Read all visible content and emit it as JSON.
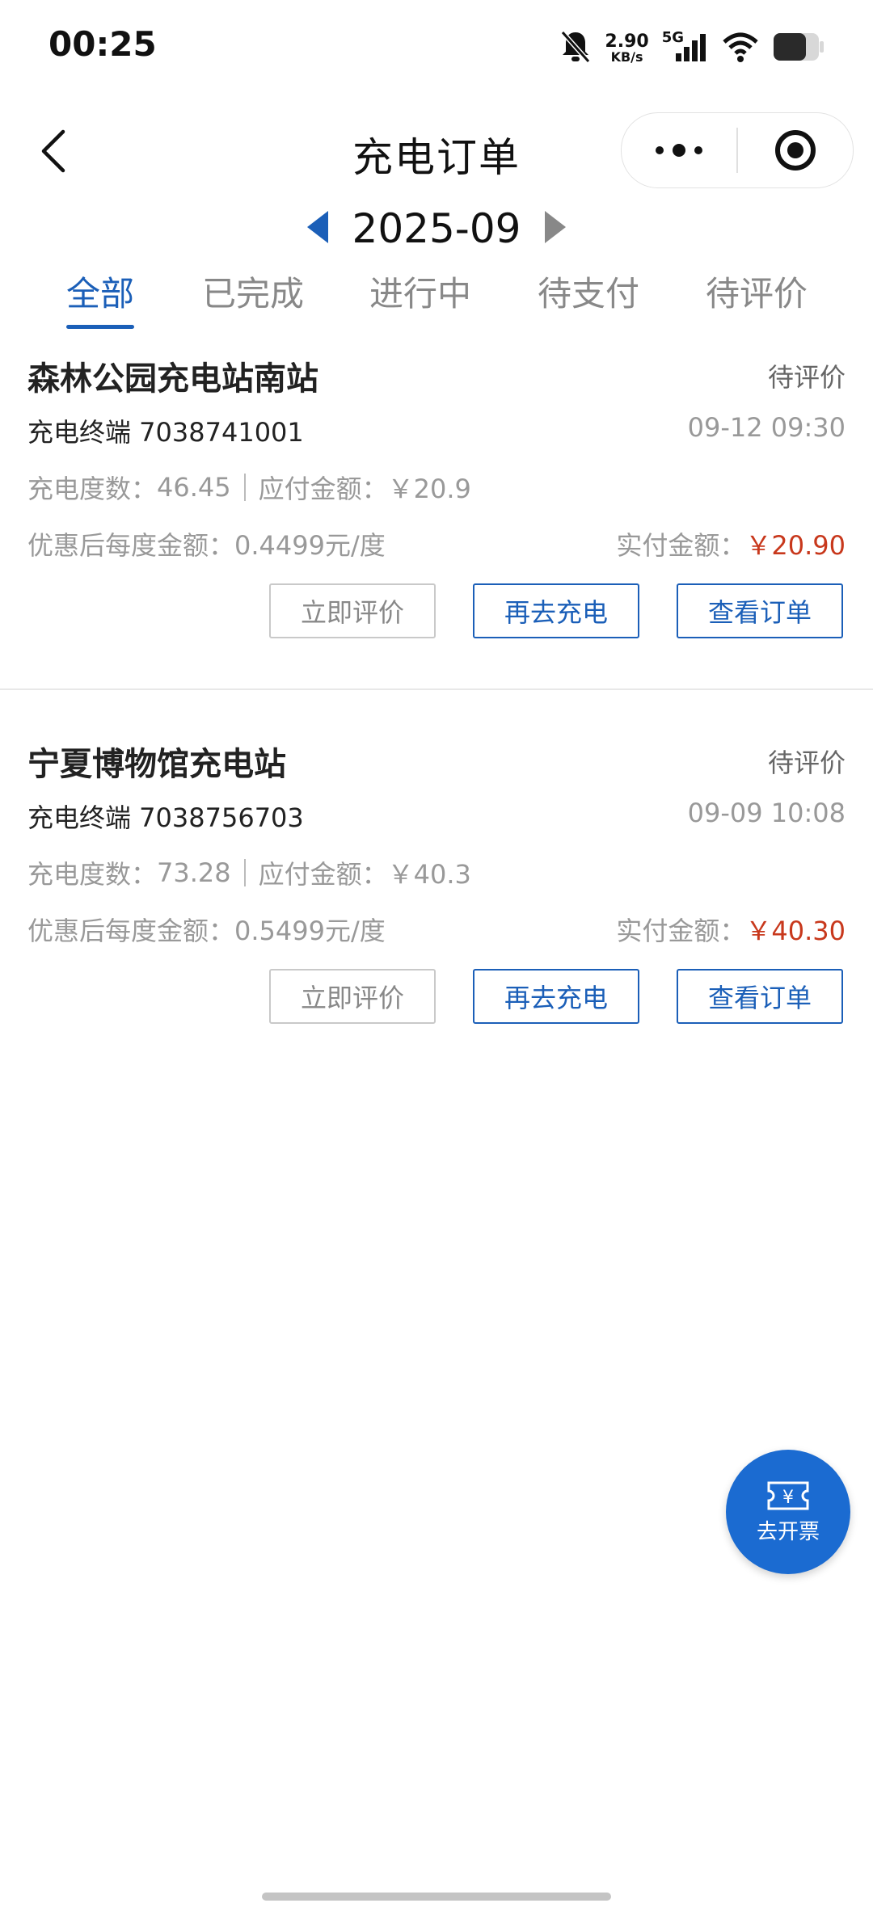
{
  "status_bar": {
    "time": "00:25",
    "net_speed_value": "2.90",
    "net_speed_unit": "KB/s",
    "network_type": "5G"
  },
  "nav": {
    "title": "充电订单"
  },
  "month_selector": {
    "month": "2025-09",
    "prev_color": "#1b5fb8",
    "next_color": "#888888"
  },
  "tabs": [
    {
      "label": "全部",
      "active": true
    },
    {
      "label": "已完成",
      "active": false
    },
    {
      "label": "进行中",
      "active": false
    },
    {
      "label": "待支付",
      "active": false
    },
    {
      "label": "待评价",
      "active": false
    }
  ],
  "orders": [
    {
      "station": "森林公园充电站南站",
      "status": "待评价",
      "terminal": "充电终端 7038741001",
      "time": "09-12 09:30",
      "kwh_label": "充电度数：",
      "kwh": "46.45",
      "due_label": "应付金额：",
      "due": "￥20.9",
      "unit_price_label": "优惠后每度金额：",
      "unit_price": "0.4499元/度",
      "paid_label": "实付金额：",
      "paid": "￥20.90",
      "buttons": [
        "立即评价",
        "再去充电",
        "查看订单"
      ]
    },
    {
      "station": "宁夏博物馆充电站",
      "status": "待评价",
      "terminal": "充电终端 7038756703",
      "time": "09-09 10:08",
      "kwh_label": "充电度数：",
      "kwh": "73.28",
      "due_label": "应付金额：",
      "due": "￥40.3",
      "unit_price_label": "优惠后每度金额：",
      "unit_price": "0.5499元/度",
      "paid_label": "实付金额：",
      "paid": "￥40.30",
      "buttons": [
        "立即评价",
        "再去充电",
        "查看订单"
      ]
    }
  ],
  "fab": {
    "label": "去开票",
    "icon_text": "¥",
    "color": "#1b6bd1"
  },
  "colors": {
    "accent": "#1b5fb8",
    "price_red": "#c8381c"
  }
}
